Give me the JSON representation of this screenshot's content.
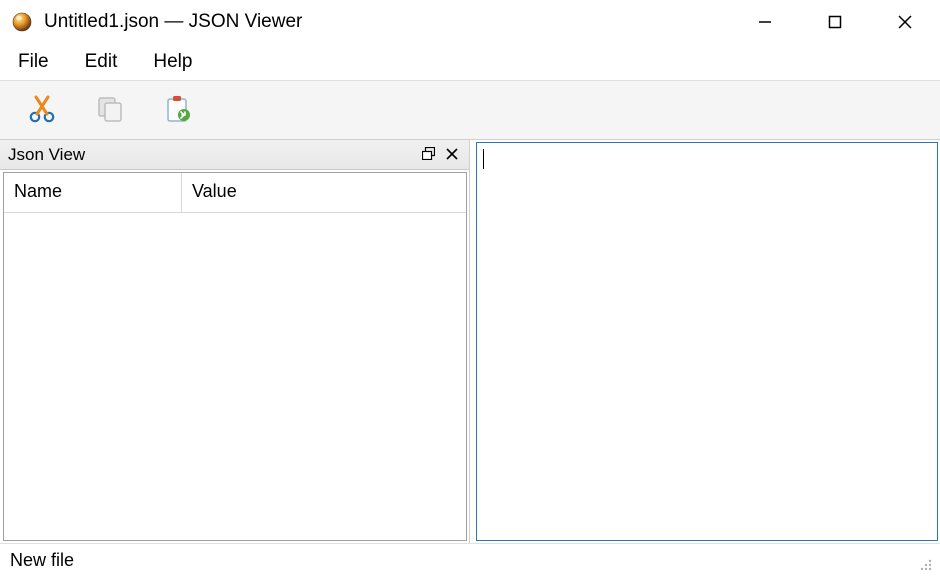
{
  "window": {
    "title": "Untitled1.json — JSON Viewer"
  },
  "menubar": {
    "items": [
      {
        "label": "File"
      },
      {
        "label": "Edit"
      },
      {
        "label": "Help"
      }
    ]
  },
  "toolbar": {
    "icons": {
      "cut": "cut-icon",
      "copy": "copy-icon",
      "paste": "paste-icon"
    }
  },
  "panel": {
    "title": "Json View"
  },
  "tree": {
    "columns": {
      "name": "Name",
      "value": "Value"
    },
    "rows": []
  },
  "editor": {
    "content": ""
  },
  "statusbar": {
    "text": "New file"
  }
}
